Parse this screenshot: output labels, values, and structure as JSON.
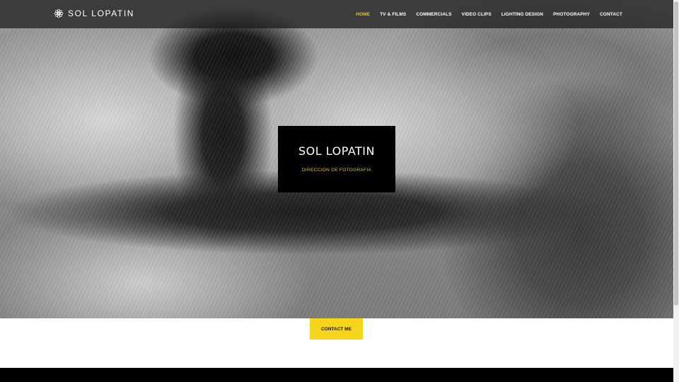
{
  "header": {
    "logo_text": "SOL LOPATIN",
    "logo_icon": "flower-icon",
    "nav": [
      {
        "label": "HOME",
        "active": true
      },
      {
        "label": "TV & FILMS",
        "active": false
      },
      {
        "label": "COMMERCIALS",
        "active": false
      },
      {
        "label": "VIDEO CLIPS",
        "active": false
      },
      {
        "label": "LIGHTING DESIGN",
        "active": false
      },
      {
        "label": "PHOTOGRAPHY",
        "active": false
      },
      {
        "label": "CONTACT",
        "active": false
      }
    ]
  },
  "hero": {
    "title": "SOL LOPATIN",
    "subtitle": "DIRECCION DE FOTOGRAFIA"
  },
  "cta": {
    "label": "CONTACT ME"
  },
  "colors": {
    "accent": "#f2c418",
    "button": "#f7d51d",
    "header_bg": "#191919",
    "title_box_bg": "#000000"
  }
}
